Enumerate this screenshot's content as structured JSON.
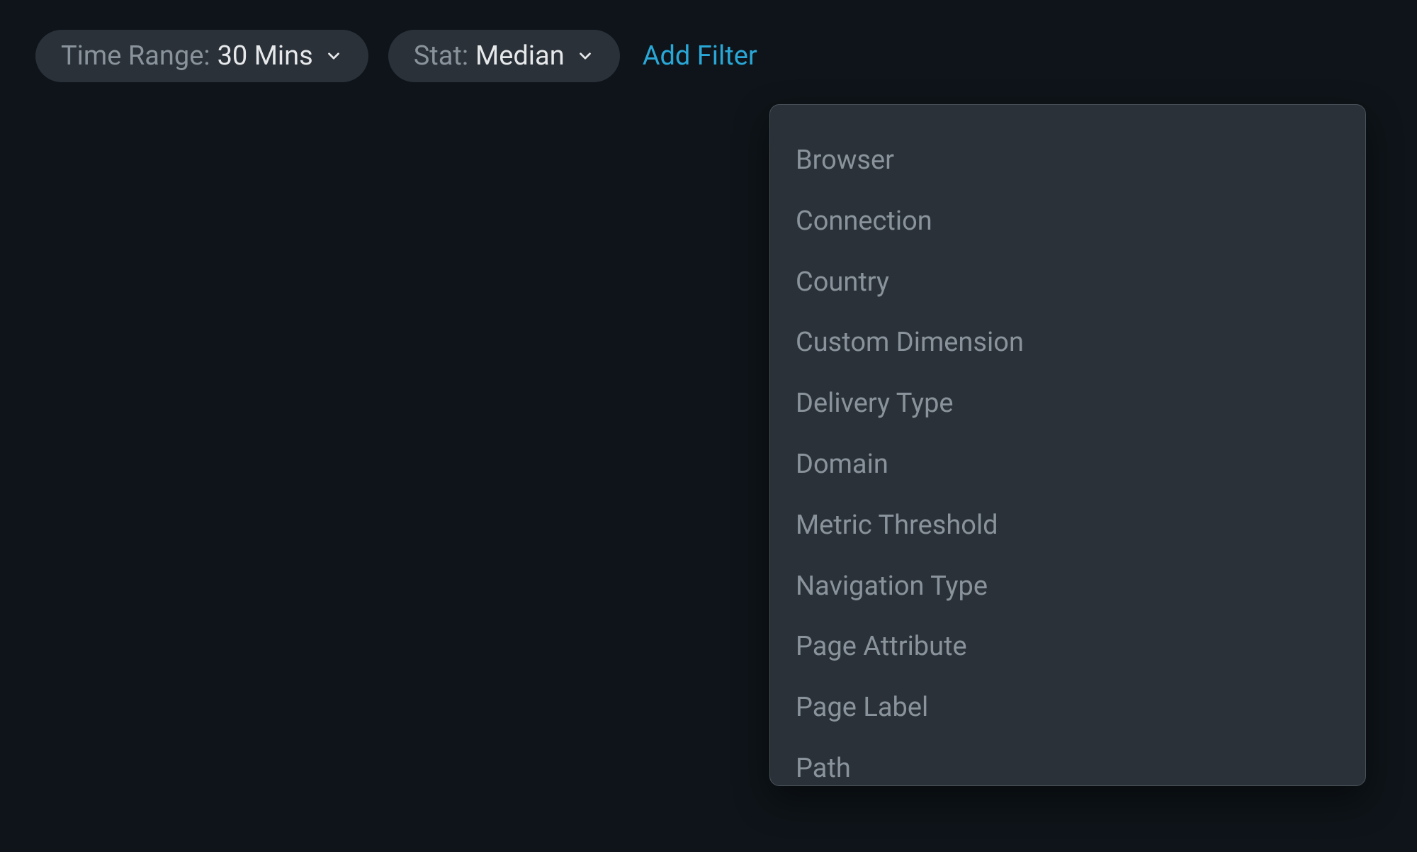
{
  "toolbar": {
    "timeRange": {
      "label": "Time Range: ",
      "value": "30 Mins"
    },
    "stat": {
      "label": "Stat: ",
      "value": "Median"
    },
    "addFilterLabel": "Add Filter"
  },
  "filterOptions": [
    "Browser",
    "Connection",
    "Country",
    "Custom Dimension",
    "Delivery Type",
    "Domain",
    "Metric Threshold",
    "Navigation Type",
    "Page Attribute",
    "Page Label",
    "Path"
  ],
  "colors": {
    "background": "#0e1419",
    "pillBackground": "#2a3139",
    "labelText": "#8a939b",
    "valueText": "#e6e8ea",
    "linkText": "#2aa7d6",
    "panelBorder": "#4a525a"
  }
}
